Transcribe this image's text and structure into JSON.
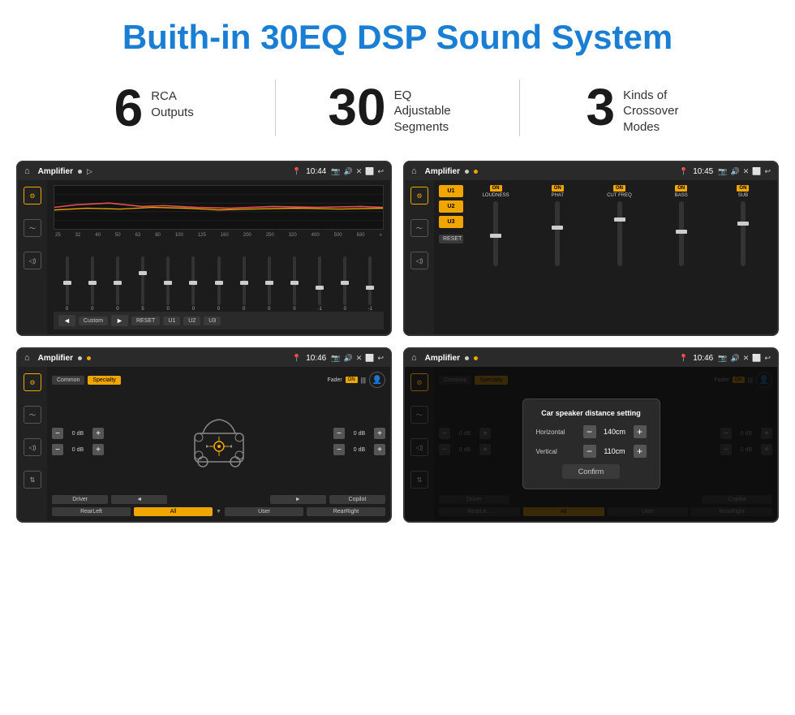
{
  "header": {
    "title": "Buith-in 30EQ DSP Sound System"
  },
  "stats": [
    {
      "number": "6",
      "label_line1": "RCA",
      "label_line2": "Outputs"
    },
    {
      "number": "30",
      "label_line1": "EQ Adjustable",
      "label_line2": "Segments"
    },
    {
      "number": "3",
      "label_line1": "Kinds of",
      "label_line2": "Crossover Modes"
    }
  ],
  "screens": [
    {
      "id": "screen1",
      "topbar": {
        "title": "Amplifier",
        "time": "10:44"
      },
      "eq_freqs": [
        "25",
        "32",
        "40",
        "50",
        "63",
        "80",
        "100",
        "125",
        "160",
        "200",
        "250",
        "320",
        "400",
        "500",
        "630"
      ],
      "eq_values": [
        "0",
        "0",
        "0",
        "5",
        "0",
        "0",
        "0",
        "0",
        "0",
        "0",
        "-1",
        "0",
        "-1"
      ],
      "bottom_btns": [
        "Custom",
        "RESET",
        "U1",
        "U2",
        "U3"
      ]
    },
    {
      "id": "screen2",
      "topbar": {
        "title": "Amplifier",
        "time": "10:45"
      },
      "presets": [
        "U1",
        "U2",
        "U3"
      ],
      "controls": [
        {
          "label": "LOUDNESS",
          "on": true
        },
        {
          "label": "PHAT",
          "on": true
        },
        {
          "label": "CUT FREQ",
          "on": true
        },
        {
          "label": "BASS",
          "on": true
        },
        {
          "label": "SUB",
          "on": true
        }
      ],
      "reset_label": "RESET"
    },
    {
      "id": "screen3",
      "topbar": {
        "title": "Amplifier",
        "time": "10:46"
      },
      "tabs": [
        "Common",
        "Specialty"
      ],
      "active_tab": "Specialty",
      "fader_label": "Fader",
      "fader_on": "ON",
      "controls": [
        {
          "label": "0 dB"
        },
        {
          "label": "0 dB"
        },
        {
          "label": "0 dB"
        },
        {
          "label": "0 dB"
        }
      ],
      "bottom_btns": [
        "Driver",
        "",
        "Copilot",
        "RearLeft",
        "All",
        "User",
        "RearRight"
      ]
    },
    {
      "id": "screen4",
      "topbar": {
        "title": "Amplifier",
        "time": "10:46"
      },
      "tabs": [
        "Common",
        "Specialty"
      ],
      "dialog": {
        "title": "Car speaker distance setting",
        "horizontal_label": "Horizontal",
        "horizontal_value": "140cm",
        "vertical_label": "Vertical",
        "vertical_value": "110cm",
        "confirm_label": "Confirm"
      },
      "bottom_btns": [
        "Driver",
        "",
        "Copilot",
        "RearLeft",
        "All",
        "User",
        "RearRight"
      ]
    }
  ]
}
